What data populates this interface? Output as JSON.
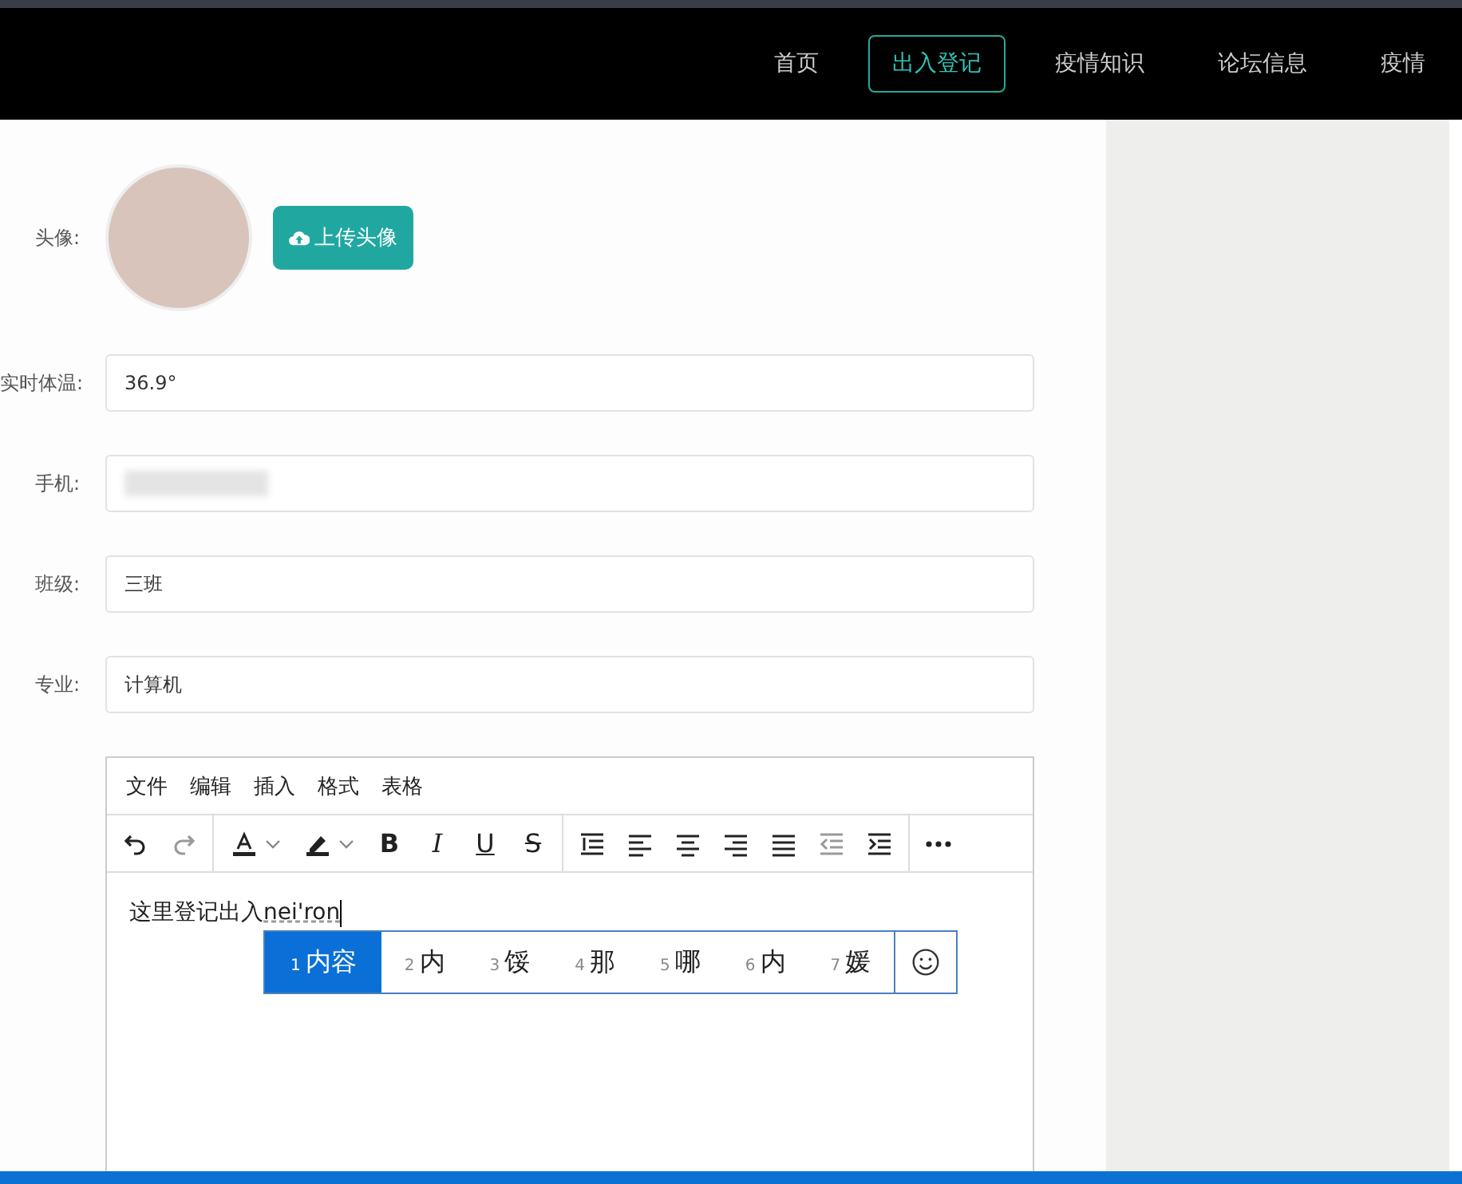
{
  "nav": {
    "items": [
      {
        "label": "首页",
        "selected": false
      },
      {
        "label": "出入登记",
        "selected": true
      },
      {
        "label": "疫情知识",
        "selected": false
      },
      {
        "label": "论坛信息",
        "selected": false
      },
      {
        "label": "疫情",
        "selected": false
      }
    ]
  },
  "form": {
    "avatar": {
      "label": "头像:",
      "upload_button": "上传头像"
    },
    "fields": [
      {
        "label": "实时体温:",
        "value": "36.9°",
        "kind": "text"
      },
      {
        "label": "手机:",
        "kind": "blurred"
      },
      {
        "label": "班级:",
        "value": "三班",
        "kind": "text"
      },
      {
        "label": "专业:",
        "value": "计算机",
        "kind": "text"
      }
    ],
    "editor": {
      "menu": [
        "文件",
        "编辑",
        "插入",
        "格式",
        "表格"
      ],
      "format_buttons": [
        {
          "label": "B",
          "kind": "bold"
        },
        {
          "label": "I",
          "kind": "italic"
        },
        {
          "label": "U",
          "kind": "underline"
        },
        {
          "label": "S",
          "kind": "strike"
        }
      ],
      "content": "这里登记出入",
      "composition": "nei'ron",
      "candidates": [
        {
          "number": "1",
          "text": "内容",
          "selected": true
        },
        {
          "number": "2",
          "text": "内",
          "selected": false
        },
        {
          "number": "3",
          "text": "馁",
          "selected": false
        },
        {
          "number": "4",
          "text": "那",
          "selected": false
        },
        {
          "number": "5",
          "text": "哪",
          "selected": false
        },
        {
          "number": "6",
          "text": "内",
          "selected": false
        },
        {
          "number": "7",
          "text": "媛",
          "selected": false
        }
      ]
    }
  }
}
